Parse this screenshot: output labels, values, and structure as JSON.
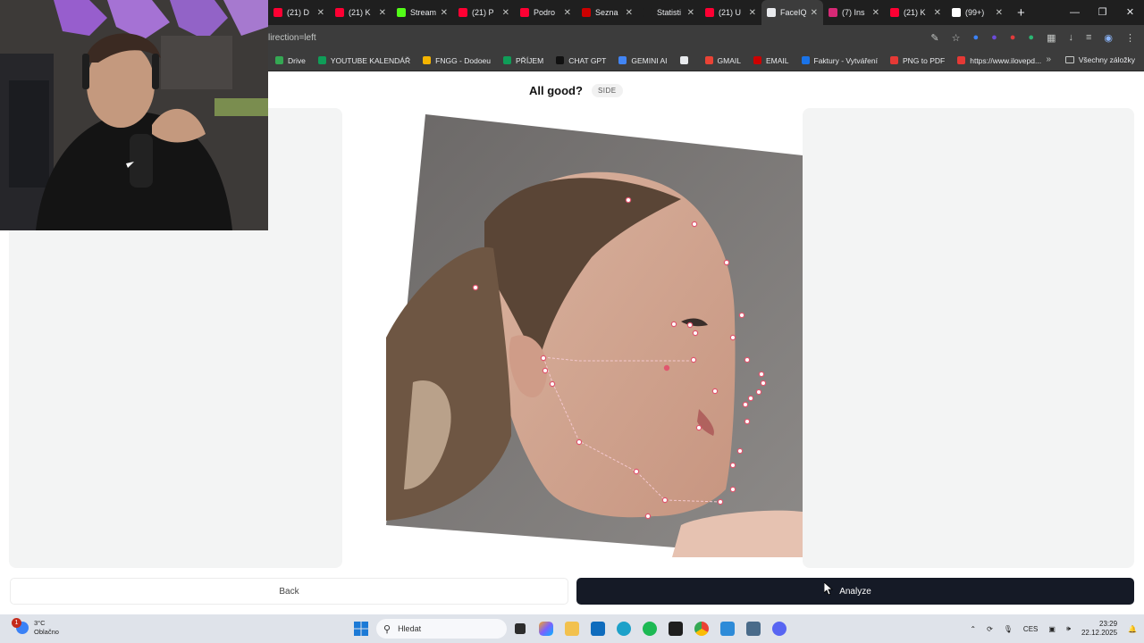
{
  "tabs": [
    {
      "label": "(21) D",
      "color": "#ff0033"
    },
    {
      "label": "(21) K",
      "color": "#ff0033"
    },
    {
      "label": "Stream",
      "color": "#53fc18"
    },
    {
      "label": "(21) P",
      "color": "#ff0033"
    },
    {
      "label": "Podro",
      "color": "#ff0033"
    },
    {
      "label": "Sezna",
      "color": "#cc0000"
    },
    {
      "label": "Statisti",
      "color": "#1f1f1f"
    },
    {
      "label": "(21) U",
      "color": "#ff0033"
    },
    {
      "label": "FaceIQ",
      "color": "#e8eaed",
      "active": true
    },
    {
      "label": "(7) Ins",
      "color": "#d62976"
    },
    {
      "label": "(21) K",
      "color": "#ff0033"
    },
    {
      "label": "(99+)",
      "color": "#ffffff"
    }
  ],
  "address": {
    "url": "lirection=left"
  },
  "bookmarks": [
    {
      "label": "Drive",
      "color": "#34a853"
    },
    {
      "label": "YOUTUBE KALENDÁŘ",
      "color": "#0f9d58"
    },
    {
      "label": "FNGG - Dodoeu",
      "color": "#f4b400"
    },
    {
      "label": "PŘÍJEM",
      "color": "#0f9d58"
    },
    {
      "label": "CHAT GPT",
      "color": "#111111"
    },
    {
      "label": "GEMINI AI",
      "color": "#4285f4"
    },
    {
      "label": "",
      "color": "#e8eaed"
    },
    {
      "label": "GMAIL",
      "color": "#ea4335"
    },
    {
      "label": "EMAIL",
      "color": "#cc0000"
    },
    {
      "label": "Faktury - Vytváření",
      "color": "#1a73e8"
    },
    {
      "label": "PNG to PDF",
      "color": "#e53935"
    },
    {
      "label": "https://www.ilovepd...",
      "color": "#e53935"
    }
  ],
  "bookmarks_folder": "Všechny záložky",
  "page": {
    "heading": "All good?",
    "badge": "SIDE",
    "back_label": "Back",
    "analyze_label": "Analyze"
  },
  "taskbar": {
    "temperature": "3°C",
    "weather": "Oblačno",
    "notification_count": "1",
    "search_placeholder": "Hledat",
    "language": "CES",
    "time": "23:29",
    "date": "22.12.2025"
  },
  "colors": {
    "analyze_bg": "#151a26",
    "landmark": "#e0566e",
    "panel_bg": "#f3f4f4"
  }
}
